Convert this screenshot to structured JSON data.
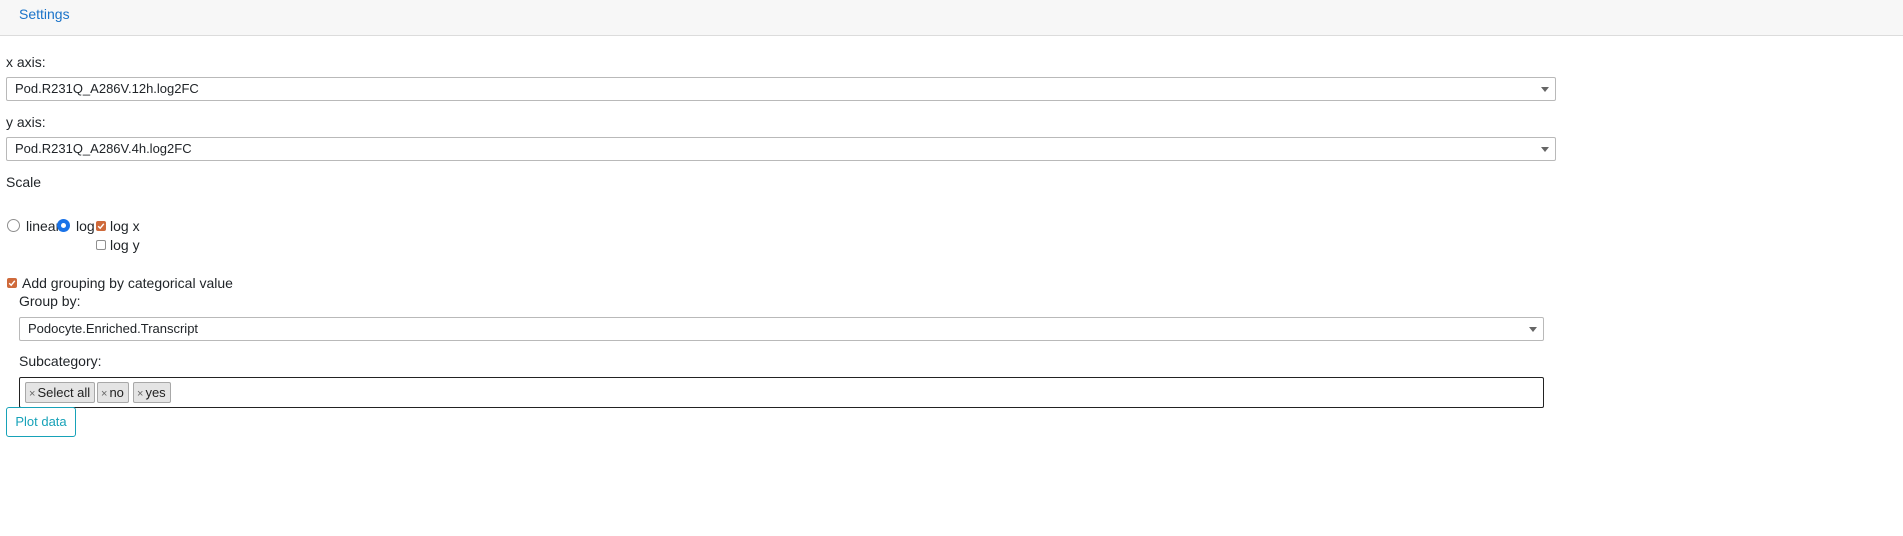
{
  "header": {
    "settings_label": "Settings"
  },
  "x_axis": {
    "label": "x axis:",
    "value": "Pod.R231Q_A286V.12h.log2FC"
  },
  "y_axis": {
    "label": "y axis:",
    "value": "Pod.R231Q_A286V.4h.log2FC"
  },
  "scale": {
    "label": "Scale",
    "options": [
      {
        "label": "linear",
        "selected": false
      },
      {
        "label": "log",
        "selected": true
      }
    ],
    "log_options": [
      {
        "label": "log x",
        "checked": true
      },
      {
        "label": "log y",
        "checked": false
      }
    ]
  },
  "grouping": {
    "checkbox_label": "Add grouping by categorical value",
    "checked": true,
    "group_by_label": "Group by:",
    "group_by_value": "Podocyte.Enriched.Transcript",
    "subcategory_label": "Subcategory:",
    "tags": [
      "Select all",
      "no",
      "yes"
    ],
    "tag_remove_glyph": "×"
  },
  "actions": {
    "plot_label": "Plot data"
  },
  "colors": {
    "link": "#1a73c9",
    "radio_selected": "#1a73e8",
    "checkbox_checked": "#cf6a3b",
    "button_outline": "#17a2b8"
  }
}
